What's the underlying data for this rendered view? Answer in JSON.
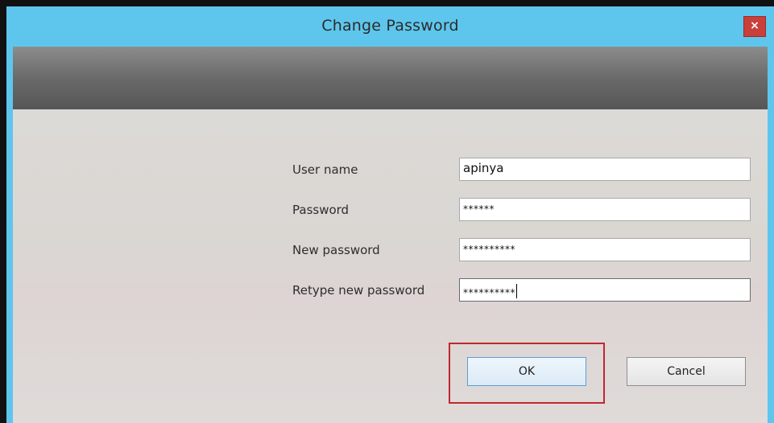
{
  "dialog": {
    "title": "Change Password",
    "close_label": "×"
  },
  "form": {
    "username_label": "User name",
    "username_value": "apinya",
    "password_label": "Password",
    "password_value": "******",
    "new_password_label": "New password",
    "new_password_value": "**********",
    "retype_label": "Retype new password",
    "retype_value": "**********"
  },
  "buttons": {
    "ok_label": "OK",
    "cancel_label": "Cancel"
  },
  "colors": {
    "titlebar": "#5ec6ec",
    "close_button": "#c9403b",
    "highlight": "#c0282d"
  }
}
